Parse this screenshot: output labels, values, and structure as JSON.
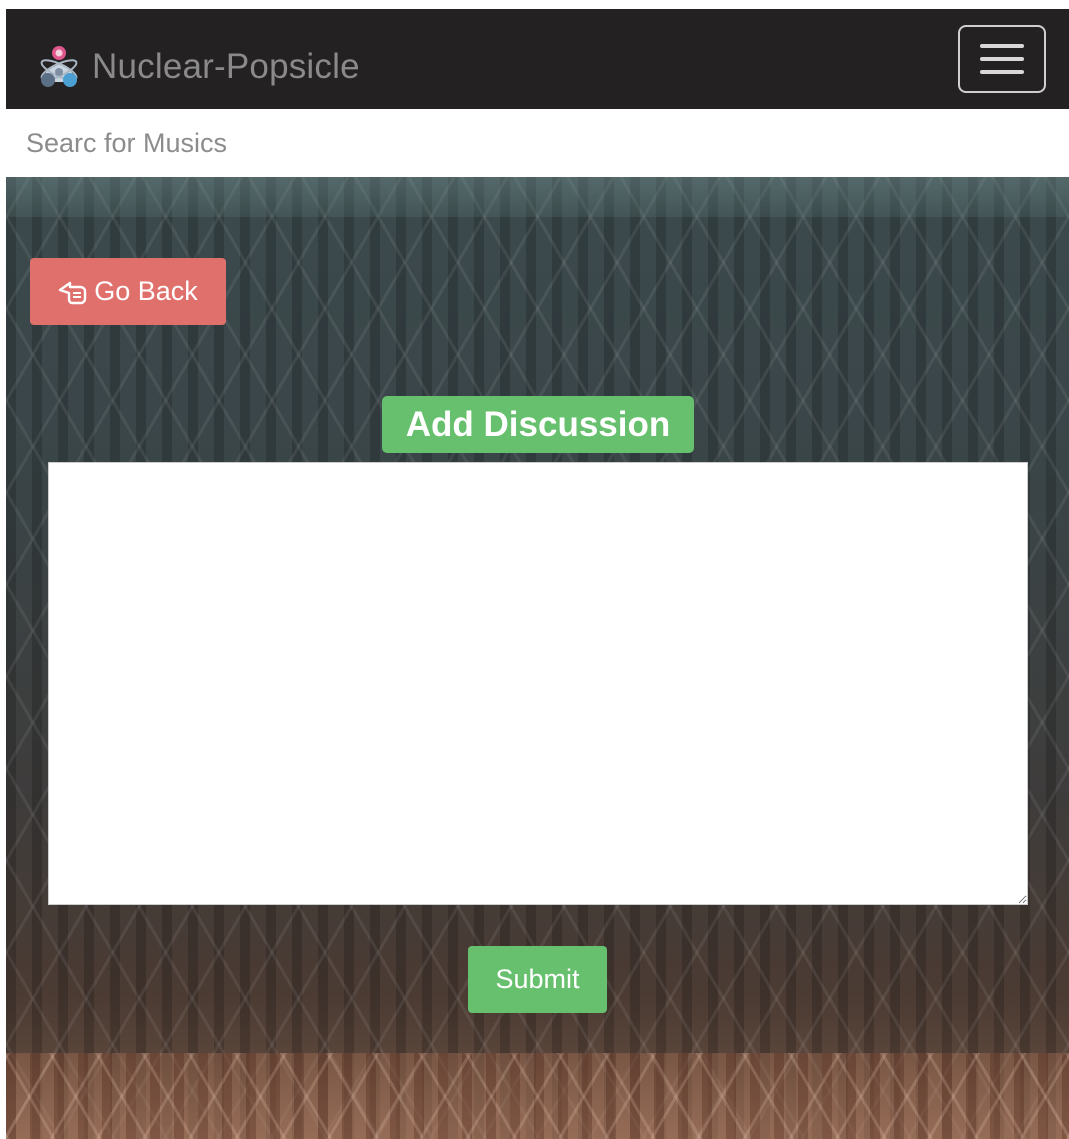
{
  "navbar": {
    "brand_name": "Nuclear-Popsicle",
    "brand_icon": "atom-people-logo-icon",
    "menu_icon": "hamburger-menu-icon"
  },
  "search": {
    "placeholder": "Searc for Musics",
    "value": ""
  },
  "actions": {
    "go_back_label": "Go Back",
    "go_back_icon": "hand-pointing-left-icon",
    "submit_label": "Submit"
  },
  "discussion": {
    "title": "Add Discussion",
    "text_value": ""
  },
  "colors": {
    "navbar_bg": "#242122",
    "brand_text": "#8a8a8a",
    "go_back_bg": "#e0706c",
    "accent_green": "#67c06d",
    "page_bg": "#ffffff"
  }
}
